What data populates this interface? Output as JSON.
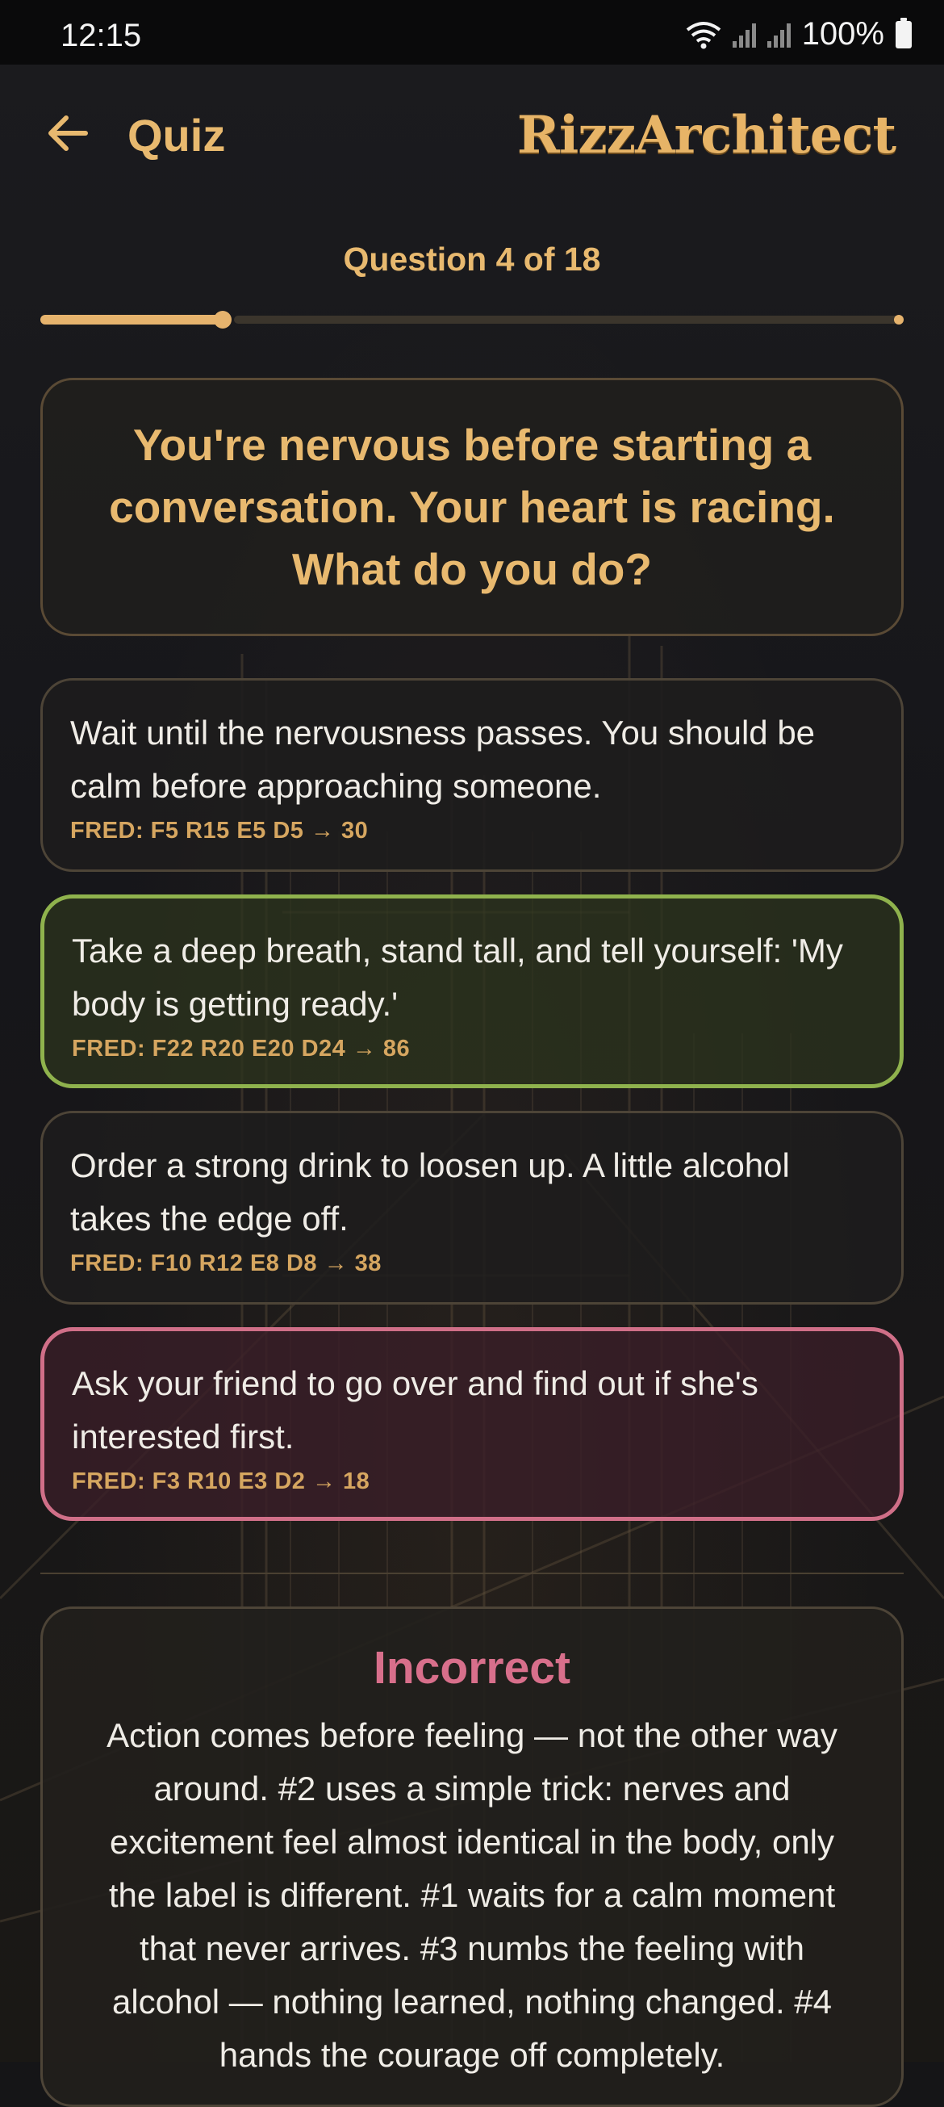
{
  "status_bar": {
    "time": "12:15",
    "battery": "100%"
  },
  "header": {
    "title": "Quiz",
    "brand": "RizzArchitect"
  },
  "progress": {
    "label": "Question 4 of 18",
    "current": 4,
    "total": 18
  },
  "question": {
    "text": "You're nervous before starting a conversation. Your heart is racing. What do you do?"
  },
  "answers": [
    {
      "text": "Wait until the nervousness passes. You should be calm before approaching someone.",
      "meta": "FRED: F5 R15 E5 D5 → 30",
      "state": "neutral"
    },
    {
      "text": "Take a deep breath, stand tall, and tell yourself: 'My body is getting ready.'",
      "meta": "FRED: F22 R20 E20 D24 → 86",
      "state": "correct"
    },
    {
      "text": "Order a strong drink to loosen up. A little alcohol takes the edge off.",
      "meta": "FRED: F10 R12 E8 D8 → 38",
      "state": "neutral"
    },
    {
      "text": "Ask your friend to go over and find out if she's interested first.",
      "meta": "FRED: F3 R10 E3 D2 → 18",
      "state": "wrong"
    }
  ],
  "feedback": {
    "title": "Incorrect",
    "text": "Action comes before feeling — not the other way around. #2 uses a simple trick: nerves and excitement feel almost identical in the body, only the label is different. #1 waits for a calm moment that never arrives. #3 numbs the feeling with alcohol — nothing learned, nothing changed. #4 hands the courage off completely."
  },
  "colors": {
    "accent": "#e8b96f",
    "correct": "#8fb24d",
    "wrong": "#d06f88"
  }
}
